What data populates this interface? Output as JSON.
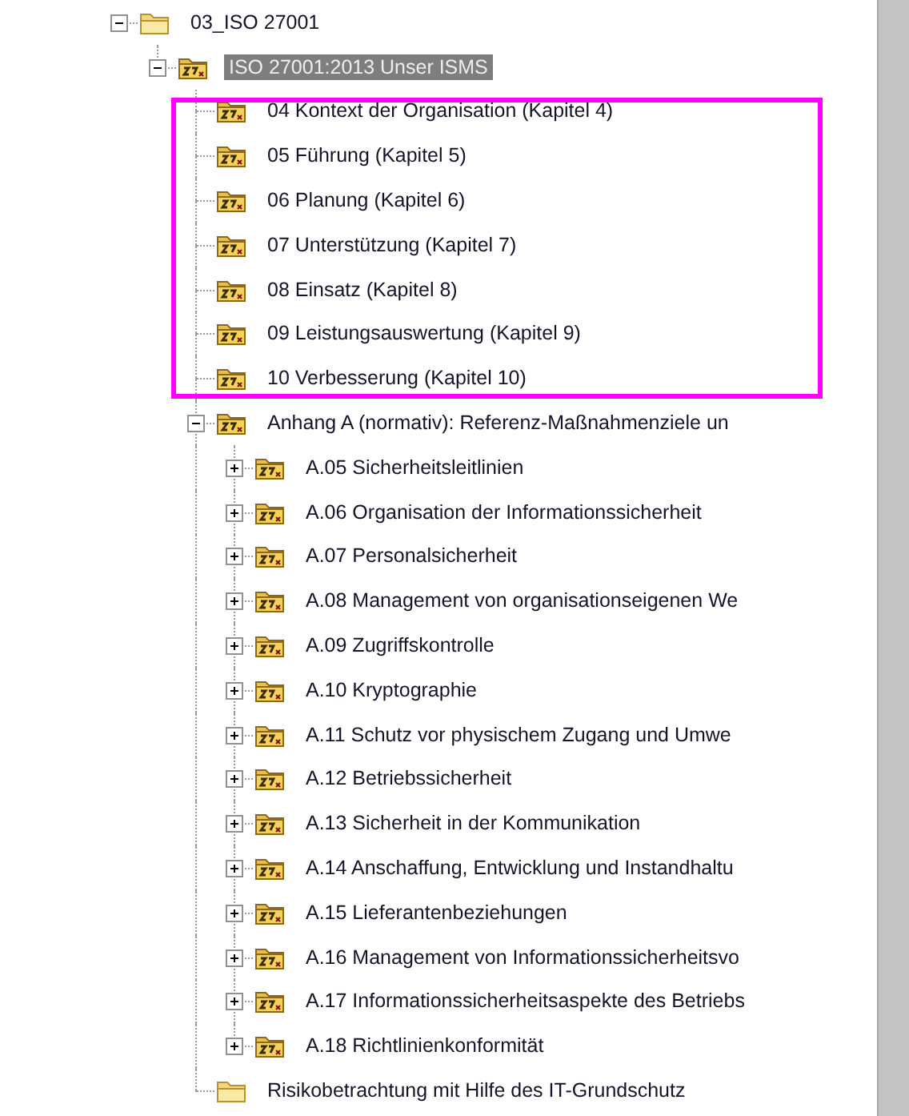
{
  "tree": [
    {
      "label": "03_ISO 27001",
      "kind": "folder",
      "expanded": true,
      "selected": false,
      "children": [
        {
          "label": "ISO 27001:2013 Unser ISMS",
          "kind": "iso-folder",
          "expanded": true,
          "selected": true,
          "children": [
            {
              "label": "04 Kontext der Organisation (Kapitel 4)",
              "kind": "iso-folder",
              "selected": false,
              "highlighted": true
            },
            {
              "label": "05 Führung (Kapitel 5)",
              "kind": "iso-folder",
              "selected": false,
              "highlighted": true
            },
            {
              "label": "06 Planung (Kapitel 6)",
              "kind": "iso-folder",
              "selected": false,
              "highlighted": true
            },
            {
              "label": "07 Unterstützung (Kapitel 7)",
              "kind": "iso-folder",
              "selected": false,
              "highlighted": true
            },
            {
              "label": "08 Einsatz (Kapitel 8)",
              "kind": "iso-folder",
              "selected": false,
              "highlighted": true
            },
            {
              "label": "09 Leistungsauswertung (Kapitel 9)",
              "kind": "iso-folder",
              "selected": false,
              "highlighted": true
            },
            {
              "label": "10 Verbesserung (Kapitel 10)",
              "kind": "iso-folder",
              "selected": false,
              "highlighted": true
            },
            {
              "label": "Anhang A (normativ): Referenz-Maßnahmenziele un",
              "kind": "iso-folder",
              "expanded": true,
              "selected": false,
              "highlighted": false,
              "children": [
                {
                  "label": "A.05 Sicherheitsleitlinien",
                  "kind": "iso-folder",
                  "expanded": false,
                  "selected": false
                },
                {
                  "label": "A.06 Organisation der Informationssicherheit",
                  "kind": "iso-folder",
                  "expanded": false,
                  "selected": false
                },
                {
                  "label": "A.07 Personalsicherheit",
                  "kind": "iso-folder",
                  "expanded": false,
                  "selected": false
                },
                {
                  "label": "A.08 Management von organisationseigenen We",
                  "kind": "iso-folder",
                  "expanded": false,
                  "selected": false
                },
                {
                  "label": "A.09 Zugriffskontrolle",
                  "kind": "iso-folder",
                  "expanded": false,
                  "selected": false
                },
                {
                  "label": "A.10 Kryptographie",
                  "kind": "iso-folder",
                  "expanded": false,
                  "selected": false
                },
                {
                  "label": "A.11 Schutz vor physischem Zugang und Umwe",
                  "kind": "iso-folder",
                  "expanded": false,
                  "selected": false
                },
                {
                  "label": "A.12 Betriebssicherheit",
                  "kind": "iso-folder",
                  "expanded": false,
                  "selected": false
                },
                {
                  "label": "A.13 Sicherheit in der Kommunikation",
                  "kind": "iso-folder",
                  "expanded": false,
                  "selected": false
                },
                {
                  "label": "A.14 Anschaffung, Entwicklung und Instandhaltu",
                  "kind": "iso-folder",
                  "expanded": false,
                  "selected": false
                },
                {
                  "label": "A.15 Lieferantenbeziehungen",
                  "kind": "iso-folder",
                  "expanded": false,
                  "selected": false
                },
                {
                  "label": "A.16 Management von Informationssicherheitsvo",
                  "kind": "iso-folder",
                  "expanded": false,
                  "selected": false
                },
                {
                  "label": "A.17 Informationssicherheitsaspekte des Betriebs",
                  "kind": "iso-folder",
                  "expanded": false,
                  "selected": false
                },
                {
                  "label": "A.18 Richtlinienkonformität",
                  "kind": "iso-folder",
                  "expanded": false,
                  "selected": false
                }
              ]
            },
            {
              "label": "Risikobetrachtung mit Hilfe des IT-Grundschutz",
              "kind": "folder",
              "selected": false,
              "highlighted": false
            }
          ]
        }
      ]
    }
  ]
}
